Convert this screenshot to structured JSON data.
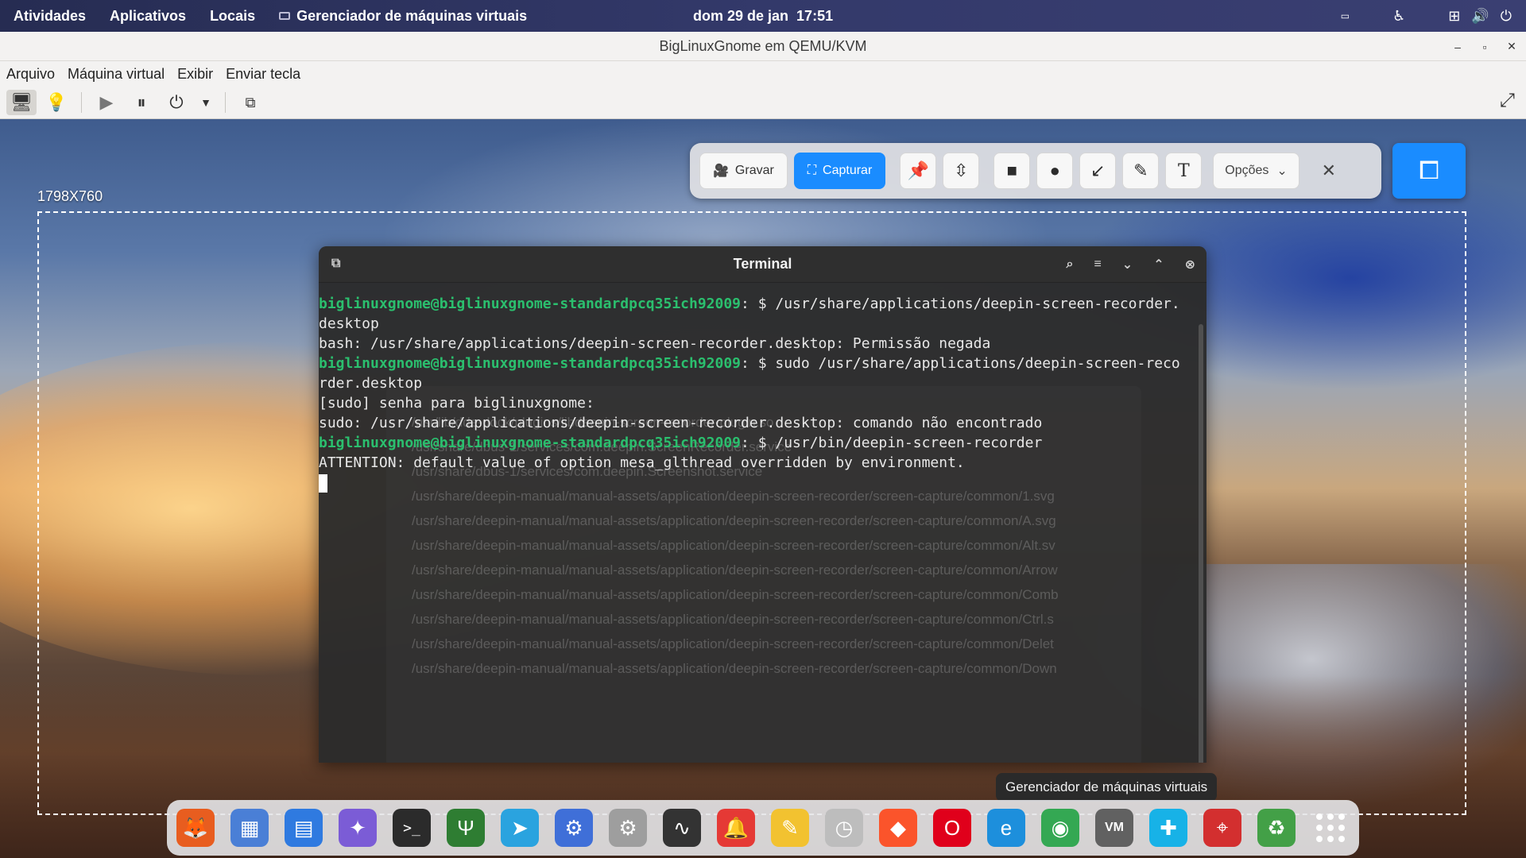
{
  "topbar": {
    "activities": "Atividades",
    "applications": "Aplicativos",
    "places": "Locais",
    "app_name": "Gerenciador de máquinas virtuais",
    "date": "dom 29 de jan",
    "time": "17:51"
  },
  "window": {
    "title": "BigLinuxGnome em QEMU/KVM",
    "menu": [
      "Arquivo",
      "Máquina virtual",
      "Exibir",
      "Enviar tecla"
    ]
  },
  "recorder": {
    "dimensions": "1798X760",
    "record_label": "Gravar",
    "capture_label": "Capturar",
    "options_label": "Opções",
    "accent": "#1a8cff"
  },
  "terminal": {
    "title": "Terminal",
    "lines": [
      {
        "prompt": "biglinuxgnome@biglinuxgnome-standardpcq35ich92009",
        "text": ": $ /usr/share/applications/deepin-screen-recorder."
      },
      {
        "prompt": "",
        "text": "desktop"
      },
      {
        "prompt": "",
        "text": "bash: /usr/share/applications/deepin-screen-recorder.desktop: Permissão negada"
      },
      {
        "prompt": "biglinuxgnome@biglinuxgnome-standardpcq35ich92009",
        "text": ": $ sudo /usr/share/applications/deepin-screen-reco"
      },
      {
        "prompt": "",
        "text": "rder.desktop"
      },
      {
        "prompt": "",
        "text": "[sudo] senha para biglinuxgnome:"
      },
      {
        "prompt": "",
        "text": "sudo: /usr/share/applications/deepin-screen-recorder.desktop: comando não encontrado"
      },
      {
        "prompt": "biglinuxgnome@biglinuxgnome-standardpcq35ich92009",
        "text": ": $ /usr/bin/deepin-screen-recorder"
      },
      {
        "prompt": "",
        "text": "ATTENTION: default value of option mesa_glthread overridden by environment."
      }
    ],
    "prompt_color": "#2bbf6e",
    "background_list": [
      "/usr/lib/dde-dock/plugins/libdeepin-screen-recorder-plugin.so",
      "/usr/share/dbus-1/services/com.deepin.ScreenRecorder.service",
      "/usr/share/dbus-1/services/com.deepin.Screenshot.service",
      "/usr/share/deepin-manual/manual-assets/application/deepin-screen-recorder/screen-capture/common/1.svg",
      "/usr/share/deepin-manual/manual-assets/application/deepin-screen-recorder/screen-capture/common/A.svg",
      "/usr/share/deepin-manual/manual-assets/application/deepin-screen-recorder/screen-capture/common/Alt.sv",
      "/usr/share/deepin-manual/manual-assets/application/deepin-screen-recorder/screen-capture/common/Arrow",
      "/usr/share/deepin-manual/manual-assets/application/deepin-screen-recorder/screen-capture/common/Comb",
      "/usr/share/deepin-manual/manual-assets/application/deepin-screen-recorder/screen-capture/common/Ctrl.s",
      "/usr/share/deepin-manual/manual-assets/application/deepin-screen-recorder/screen-capture/common/Delet",
      "/usr/share/deepin-manual/manual-assets/application/deepin-screen-recorder/screen-capture/common/Down"
    ]
  },
  "tooltip": "Gerenciador de máquinas virtuais",
  "dock": {
    "icons": [
      {
        "name": "firefox-icon",
        "color": "#e85d1f"
      },
      {
        "name": "calendar-icon",
        "color": "#4a7fd6"
      },
      {
        "name": "document-icon",
        "color": "#2f7ae0"
      },
      {
        "name": "apps-icon",
        "color": "#7b5cd6"
      },
      {
        "name": "terminal-icon",
        "color": "#2b2b2b"
      },
      {
        "name": "biglinux-icon",
        "color": "#2e7d32"
      },
      {
        "name": "telegram-icon",
        "color": "#2aa3df"
      },
      {
        "name": "settings-mixer-icon",
        "color": "#3f6fd8"
      },
      {
        "name": "settings-gear-icon",
        "color": "#9e9e9e"
      },
      {
        "name": "system-monitor-icon",
        "color": "#333333"
      },
      {
        "name": "notification-bell-icon",
        "color": "#e53935"
      },
      {
        "name": "text-editor-icon",
        "color": "#f2c230"
      },
      {
        "name": "clock-icon",
        "color": "#bdbdbd"
      },
      {
        "name": "brave-icon",
        "color": "#fb542b"
      },
      {
        "name": "opera-icon",
        "color": "#e0001b"
      },
      {
        "name": "edge-icon",
        "color": "#1d8fdc"
      },
      {
        "name": "chrome-icon",
        "color": "#34a853"
      },
      {
        "name": "virt-manager-icon",
        "color": "#616161"
      },
      {
        "name": "kodi-icon",
        "color": "#17b2e7"
      },
      {
        "name": "crosshair-icon",
        "color": "#d32f2f"
      },
      {
        "name": "recycle-icon",
        "color": "#43a047"
      }
    ]
  }
}
